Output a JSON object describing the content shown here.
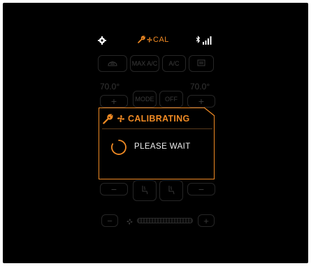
{
  "status_bar": {
    "settings_icon": "gear-icon",
    "calibration_label": "CAL",
    "calibration_icons": [
      "wrench-icon",
      "fan-icon"
    ],
    "bluetooth_icon": "bluetooth-icon",
    "signal_icon": "signal-bars-icon"
  },
  "background": {
    "mode_buttons": [
      {
        "icon": "defrost-front-icon"
      },
      {
        "label": "MAX A/C"
      },
      {
        "label": "A/C"
      },
      {
        "icon": "defrost-rear-icon"
      }
    ],
    "temp_left": "70.0°",
    "temp_right": "70.0°",
    "plus_label": "+",
    "minus_label": "−",
    "center_buttons": [
      {
        "label": "MODE"
      },
      {
        "label": "OFF"
      }
    ],
    "seat_buttons": [
      {
        "icon": "seat-heat-left-icon"
      },
      {
        "icon": "seat-heat-right-icon"
      }
    ],
    "fan_minus": "−",
    "fan_plus": "+",
    "fan_icon": "fan-icon"
  },
  "dialog": {
    "title": "CALIBRATING",
    "message": "PLEASE WAIT",
    "accent_color": "#f08a24"
  }
}
